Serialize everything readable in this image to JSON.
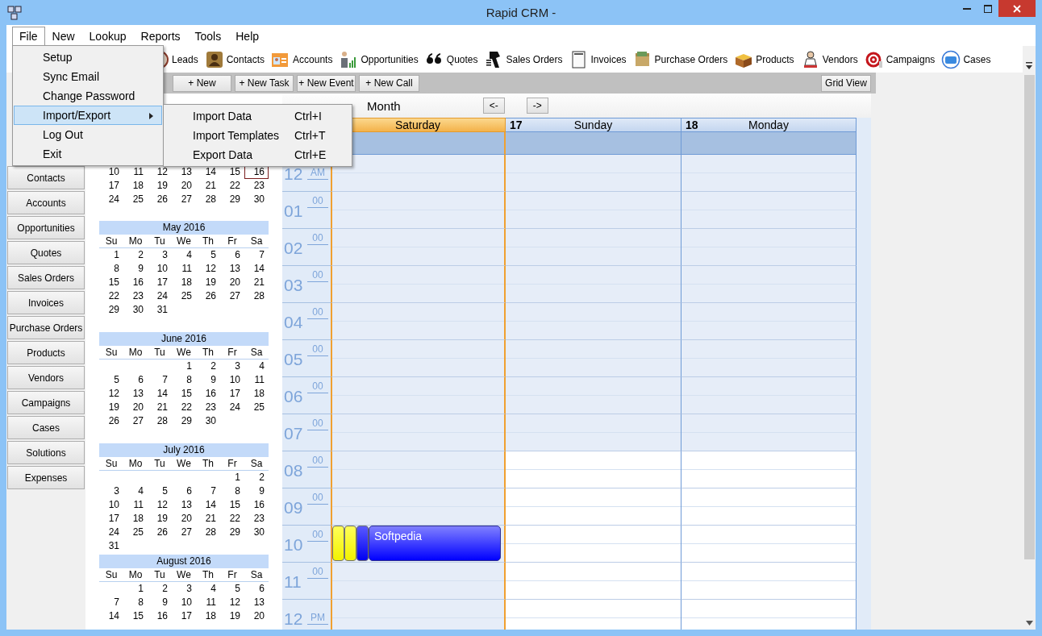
{
  "window": {
    "title": "Rapid CRM -"
  },
  "menu_bar": [
    {
      "label": "File",
      "selected": true
    },
    {
      "label": "New",
      "selected": false
    },
    {
      "label": "Lookup",
      "selected": false
    },
    {
      "label": "Reports",
      "selected": false
    },
    {
      "label": "Tools",
      "selected": false
    },
    {
      "label": "Help",
      "selected": false
    }
  ],
  "file_menu": [
    {
      "label": "Setup",
      "selected": false,
      "submenu": false
    },
    {
      "label": "Sync Email",
      "selected": false,
      "submenu": false
    },
    {
      "label": "Change Password",
      "selected": false,
      "submenu": false
    },
    {
      "label": "Import/Export",
      "selected": true,
      "submenu": true
    },
    {
      "label": "Log Out",
      "selected": false,
      "submenu": false
    },
    {
      "label": "Exit",
      "selected": false,
      "submenu": false
    }
  ],
  "submenu": [
    {
      "label": "Import Data",
      "shortcut": "Ctrl+I"
    },
    {
      "label": "Import Templates",
      "shortcut": "Ctrl+T"
    },
    {
      "label": "Export Data",
      "shortcut": "Ctrl+E"
    }
  ],
  "toolbar": [
    "Leads",
    "Contacts",
    "Accounts",
    "Opportunities",
    "Quotes",
    "Sales Orders",
    "Invoices",
    "Purchase Orders",
    "Products",
    "Vendors",
    "Campaigns",
    "Cases"
  ],
  "nav_buttons": [
    "Contacts",
    "Accounts",
    "Opportunities",
    "Quotes",
    "Sales Orders",
    "Invoices",
    "Purchase Orders",
    "Products",
    "Vendors",
    "Campaigns",
    "Cases",
    "Solutions",
    "Expenses"
  ],
  "action_buttons": [
    "+ New",
    "+ New Task",
    "+ New Event",
    "+ New Call"
  ],
  "grid_view_button": "Grid View",
  "view_label": "Month",
  "nav_arrows": [
    "<-",
    "->"
  ],
  "mini_calendars": [
    {
      "weeks": [
        [
          "10",
          "11",
          "12",
          "13",
          "14",
          "15",
          {
            "day": "16",
            "today": true
          }
        ],
        [
          "17",
          "18",
          "19",
          "20",
          "21",
          "22",
          "23"
        ],
        [
          "24",
          "25",
          "26",
          "27",
          "28",
          "29",
          "30"
        ]
      ]
    },
    {
      "title": "May 2016",
      "weekdays": [
        "Su",
        "Mo",
        "Tu",
        "We",
        "Th",
        "Fr",
        "Sa"
      ],
      "weeks": [
        [
          "1",
          "2",
          "3",
          "4",
          "5",
          "6",
          "7"
        ],
        [
          "8",
          "9",
          "10",
          "11",
          "12",
          "13",
          "14"
        ],
        [
          "15",
          "16",
          "17",
          "18",
          "19",
          "20",
          "21"
        ],
        [
          "22",
          "23",
          "24",
          "25",
          "26",
          "27",
          "28"
        ],
        [
          "29",
          "30",
          "31"
        ]
      ]
    },
    {
      "title": "June 2016",
      "weekdays": [
        "Su",
        "Mo",
        "Tu",
        "We",
        "Th",
        "Fr",
        "Sa"
      ],
      "weeks": [
        [
          "1",
          "2",
          "3",
          "4"
        ],
        [
          "5",
          "6",
          "7",
          "8",
          "9",
          "10",
          "11"
        ],
        [
          "12",
          "13",
          "14",
          "15",
          "16",
          "17",
          "18"
        ],
        [
          "19",
          "20",
          "21",
          "22",
          "23",
          "24",
          "25"
        ],
        [
          "26",
          "27",
          "28",
          "29",
          "30"
        ]
      ]
    },
    {
      "title": "July 2016",
      "weekdays": [
        "Su",
        "Mo",
        "Tu",
        "We",
        "Th",
        "Fr",
        "Sa"
      ],
      "weeks": [
        [
          "1",
          "2"
        ],
        [
          "3",
          "4",
          "5",
          "6",
          "7",
          "8",
          "9"
        ],
        [
          "10",
          "11",
          "12",
          "13",
          "14",
          "15",
          "16"
        ],
        [
          "17",
          "18",
          "19",
          "20",
          "21",
          "22",
          "23"
        ],
        [
          "24",
          "25",
          "26",
          "27",
          "28",
          "29",
          "30"
        ],
        [
          "31"
        ]
      ]
    },
    {
      "title": "August 2016",
      "weekdays": [
        "Su",
        "Mo",
        "Tu",
        "We",
        "Th",
        "Fr",
        "Sa"
      ],
      "weeks": [
        [
          "1",
          "2",
          "3",
          "4",
          "5",
          "6"
        ],
        [
          "7",
          "8",
          "9",
          "10",
          "11",
          "12",
          "13"
        ],
        [
          "14",
          "15",
          "16",
          "17",
          "18",
          "19",
          "20"
        ]
      ]
    }
  ],
  "days": [
    {
      "name": "Saturday",
      "selected": true
    },
    {
      "date": "17",
      "name": "Sunday",
      "selected": false
    },
    {
      "date": "18",
      "name": "Monday",
      "selected": false
    }
  ],
  "hours": [
    {
      "hour": "12",
      "suffix": "AM",
      "working": false
    },
    {
      "hour": "01",
      "minute": "00",
      "working": false
    },
    {
      "hour": "02",
      "minute": "00",
      "working": false
    },
    {
      "hour": "03",
      "minute": "00",
      "working": false
    },
    {
      "hour": "04",
      "minute": "00",
      "working": false
    },
    {
      "hour": "05",
      "minute": "00",
      "working": false
    },
    {
      "hour": "06",
      "minute": "00",
      "working": false
    },
    {
      "hour": "07",
      "minute": "00",
      "working": false
    },
    {
      "hour": "08",
      "minute": "00",
      "working": true
    },
    {
      "hour": "09",
      "minute": "00",
      "working": true
    },
    {
      "hour": "10",
      "minute": "00",
      "working": true,
      "events": [
        {
          "kind": "bar",
          "color": "#ffff00"
        },
        {
          "kind": "bar",
          "color": "#ffff00"
        },
        {
          "kind": "bar",
          "color": "#0000ff"
        },
        {
          "kind": "appointment",
          "title": "Softpedia",
          "color": "#0000ff"
        }
      ]
    },
    {
      "hour": "11",
      "minute": "00",
      "working": true
    },
    {
      "hour": "12",
      "suffix": "PM",
      "working": true
    }
  ]
}
